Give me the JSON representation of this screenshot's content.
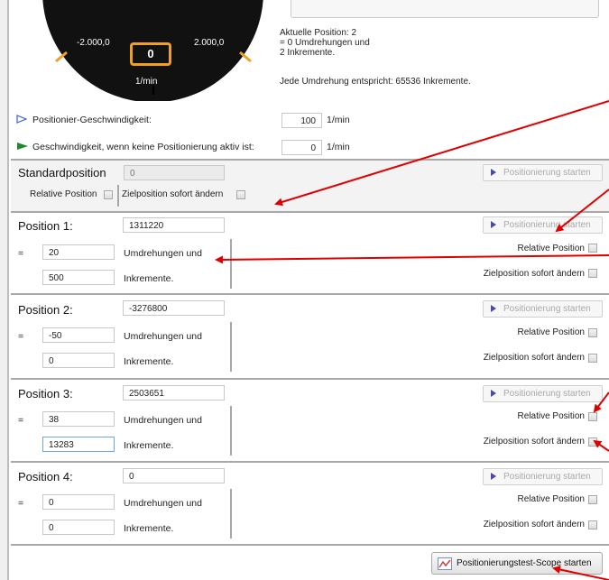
{
  "gauge": {
    "min_label": "-2.000,0",
    "max_label": "2.000,0",
    "value": "0",
    "unit": "1/min"
  },
  "info": {
    "line1": "Aktuelle Position: 2",
    "line2": " = 0 Umdrehungen und",
    "line3": "2 Inkremente.",
    "line4": "Jede Umdrehung entspricht: 65536 Inkremente."
  },
  "speed": {
    "label": "Positionier-Geschwindigkeit:",
    "value": "100",
    "unit": "1/min"
  },
  "idle_speed": {
    "label": "Geschwindigkeit, wenn keine Positionierung aktiv ist:",
    "value": "0",
    "unit": "1/min"
  },
  "standard": {
    "title": "Standardposition",
    "value": "0",
    "start_label": "Positionierung starten",
    "relative_label": "Relative Position",
    "immediate_label": "Zielposition sofort ändern"
  },
  "common": {
    "eq": "=",
    "rev_label": "Umdrehungen und",
    "inc_label": "Inkremente.",
    "start_label": "Positionierung starten",
    "relative_label": "Relative Position",
    "immediate_label": "Zielposition sofort ändern"
  },
  "positions": [
    {
      "title": "Position 1:",
      "total": "1311220",
      "revs": "20",
      "incs": "500"
    },
    {
      "title": "Position 2:",
      "total": "-3276800",
      "revs": "-50",
      "incs": "0"
    },
    {
      "title": "Position 3:",
      "total": "2503651",
      "revs": "38",
      "incs": "13283"
    },
    {
      "title": "Position 4:",
      "total": "0",
      "revs": "0",
      "incs": "0"
    }
  ],
  "scope_button": "Positionierungstest-Scope starten",
  "colors": {
    "annotation_arrow": "#e00000",
    "gauge_accent": "#f0a020",
    "play_icon": "#4a4aa0"
  }
}
